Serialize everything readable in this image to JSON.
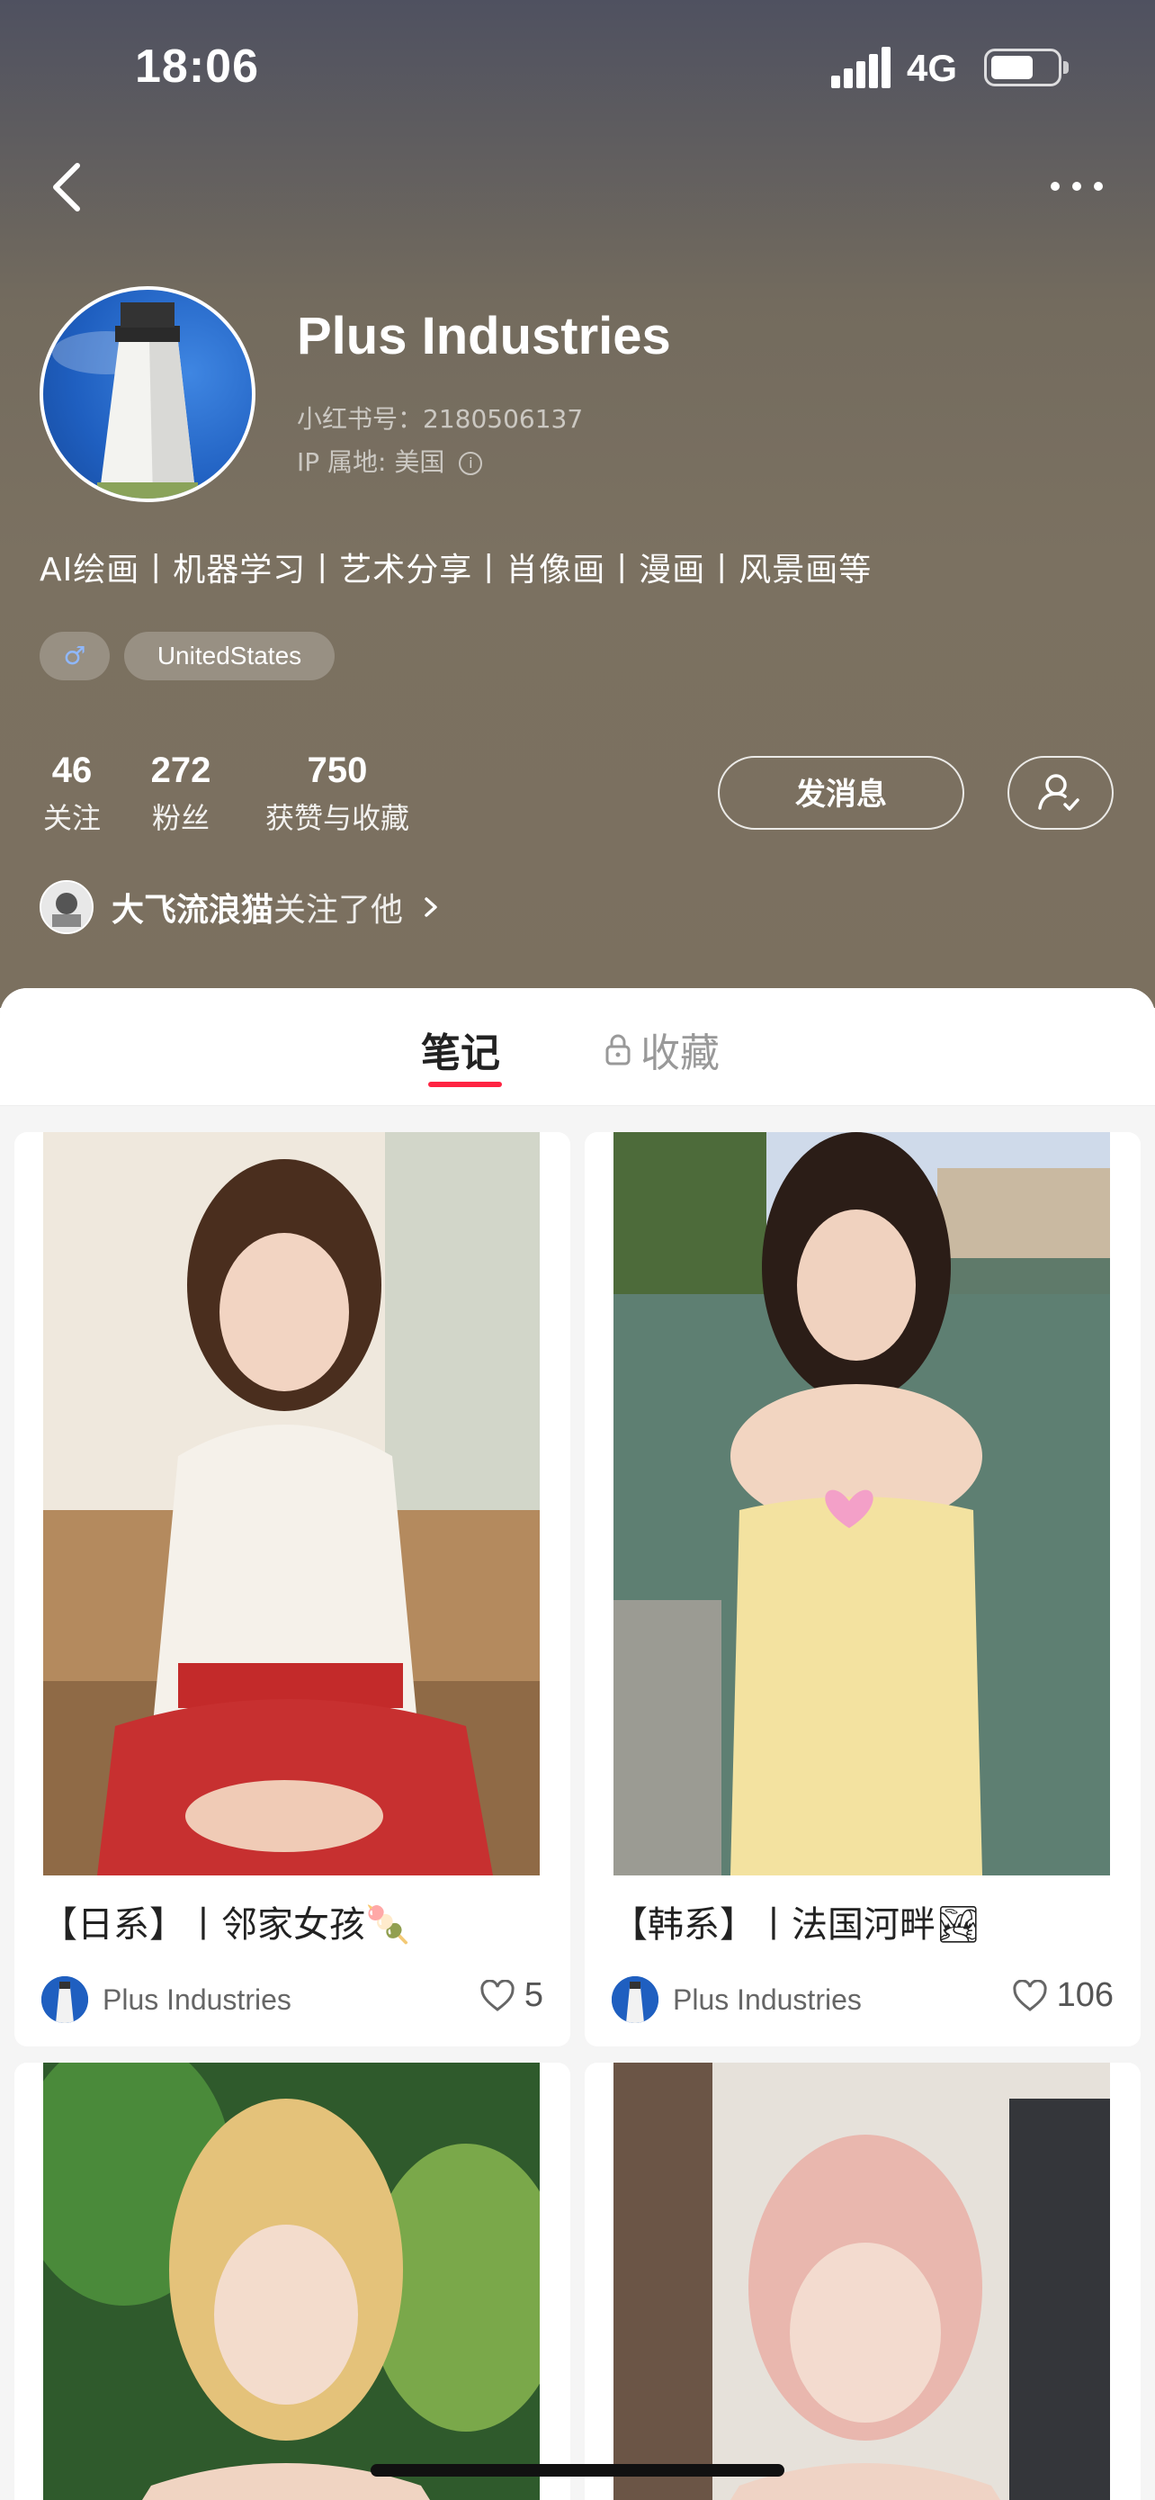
{
  "status_bar": {
    "time": "18:06",
    "network": "4G",
    "battery_level": 0.62
  },
  "profile": {
    "name": "Plus Industries",
    "red_id": "小红书号：2180506137",
    "ip_location": "IP 属地: 美国",
    "bio": "AI绘画丨机器学习丨艺术分享丨肖像画丨漫画丨风景画等",
    "gender_symbol": "♂",
    "location_tag": "UnitedStates",
    "stats": [
      {
        "value": "46",
        "label": "关注"
      },
      {
        "value": "272",
        "label": "粉丝"
      },
      {
        "value": "750",
        "label": "获赞与收藏"
      }
    ],
    "message_button": "发消息",
    "followed_by_name": "大飞流浪猫",
    "followed_by_text": " 关注了他",
    "icons": {
      "back": "back-chevron-icon",
      "more": "more-dots-icon",
      "follow": "user-check-icon",
      "info": "info-icon"
    }
  },
  "tabs": [
    {
      "label": "笔记",
      "active": true
    },
    {
      "label": "收藏",
      "active": false,
      "locked": true
    }
  ],
  "notes": [
    {
      "title": "【日系】丨邻家女孩🍡",
      "author": "Plus Industries",
      "likes": "5"
    },
    {
      "title": "【韩系】丨法国河畔🏞",
      "author": "Plus Industries",
      "likes": "106"
    },
    {
      "title": "",
      "author": "",
      "likes": ""
    },
    {
      "title": "",
      "author": "",
      "likes": ""
    }
  ],
  "colors": {
    "accent": "#ff2442",
    "header_brown": "#7b705f",
    "header_top": "#4f5160"
  }
}
